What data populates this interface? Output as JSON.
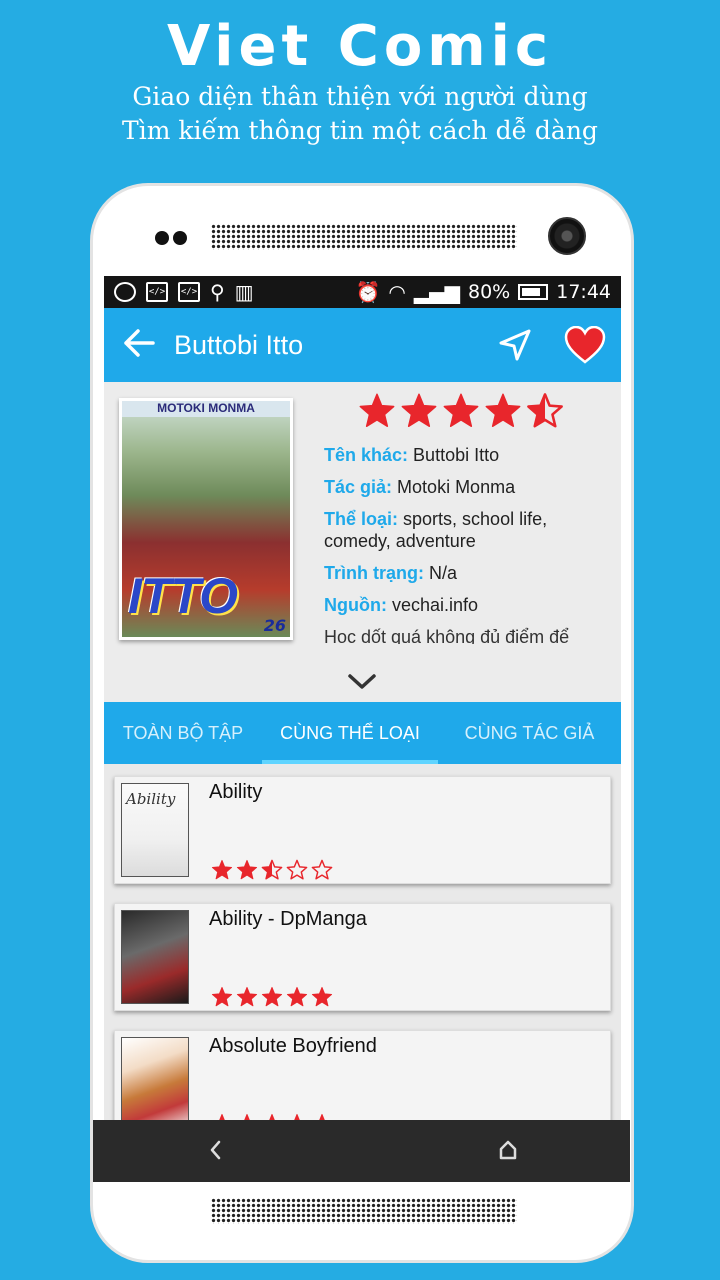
{
  "promo": {
    "title": "Viet Comic",
    "subtitle_1": "Giao diện thân thiện với người dùng",
    "subtitle_2": "Tìm kiếm thông tin một cách dễ dàng"
  },
  "status_bar": {
    "battery": "80%",
    "time": "17:44"
  },
  "app_bar": {
    "title": "Buttobi Itto"
  },
  "detail": {
    "rating": 4.5,
    "cover": {
      "author": "MOTOKI MONMA",
      "title": "ITTO",
      "volume": "26"
    },
    "info": [
      {
        "key": "Tên khác:",
        "value": "Buttobi Itto"
      },
      {
        "key": "Tác giả:",
        "value": "Motoki Monma"
      },
      {
        "key": "Thể loại:",
        "value": "sports, school life, comedy, adventure"
      },
      {
        "key": "Trình trạng:",
        "value": "N/a"
      },
      {
        "key": "Nguồn:",
        "value": "vechai.info"
      }
    ],
    "description": "Học dốt quá không đủ điểm để"
  },
  "tabs": [
    {
      "label": "TOÀN BỘ TẬP",
      "active": false
    },
    {
      "label": "CÙNG THỂ LOẠI",
      "active": true
    },
    {
      "label": "CÙNG TÁC GIẢ",
      "active": false
    }
  ],
  "list": [
    {
      "title": "Ability",
      "rating": 2.5,
      "thumb_text": "Ability"
    },
    {
      "title": "Ability - DpManga",
      "rating": 5
    },
    {
      "title": "Absolute Boyfriend",
      "rating": 5
    }
  ],
  "colors": {
    "accent": "#1fa9ea",
    "background": "#25ace3",
    "star": "#e8262c"
  }
}
